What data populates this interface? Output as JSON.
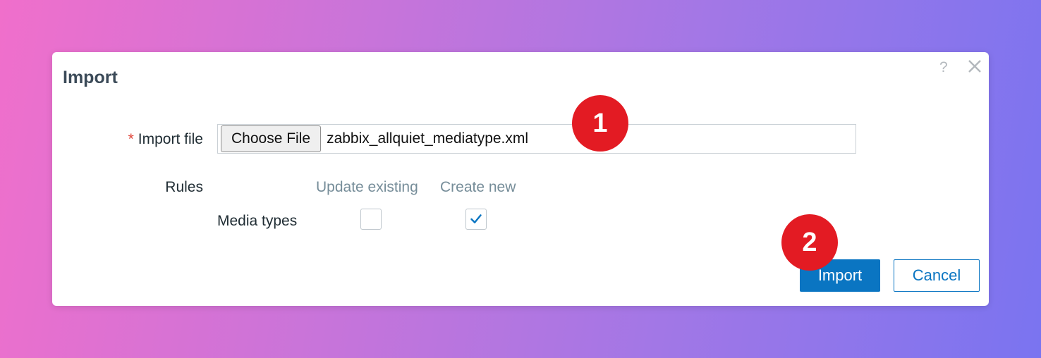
{
  "dialog": {
    "title": "Import",
    "help_glyph": "?",
    "close_icon": "close-icon"
  },
  "form": {
    "import_file": {
      "required_marker": "*",
      "label": "Import file",
      "choose_button": "Choose File",
      "file_name": "zabbix_allquiet_mediatype.xml"
    },
    "rules": {
      "label": "Rules",
      "columns": [
        "Update existing",
        "Create new"
      ],
      "rows": [
        {
          "label": "Media types",
          "update_existing": false,
          "create_new": true
        }
      ]
    }
  },
  "buttons": {
    "import": "Import",
    "cancel": "Cancel"
  },
  "annotations": [
    "1",
    "2"
  ],
  "colors": {
    "primary": "#0a75c2",
    "badge": "#e31b23",
    "title": "#3b4a58"
  }
}
